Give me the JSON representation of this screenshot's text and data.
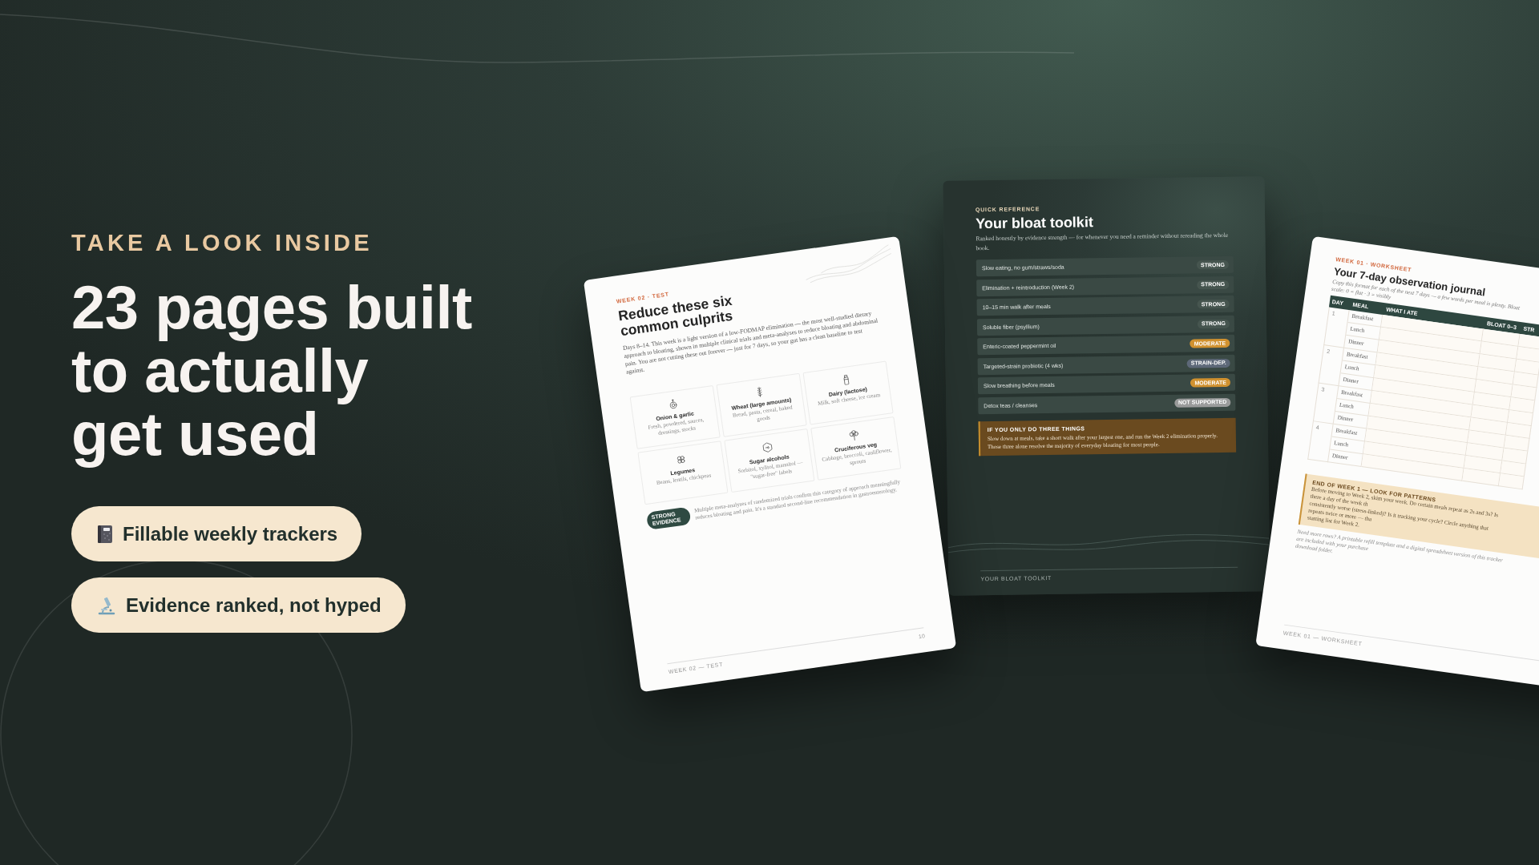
{
  "hero": {
    "eyebrow": "TAKE A LOOK INSIDE",
    "headline": "23 pages built\nto actually\nget used",
    "features": [
      {
        "kind": "notebook",
        "label": "Fillable weekly trackers"
      },
      {
        "kind": "microscope",
        "label": "Evidence ranked, not hyped"
      }
    ]
  },
  "pages": [
    {
      "kind": "culprits",
      "label": "WEEK 02 · TEST",
      "title": "Reduce these six common culprits",
      "intro": "Days 8–14. This week is a light version of a low-FODMAP elimination — the most well-studied dietary approach to bloating, shown in multiple clinical trials and meta-analyses to reduce bloating and abdominal pain. You are not cutting these out forever — just for 7 days, so your gut has a clean baseline to test against.",
      "items": [
        {
          "kind": "onion",
          "name": "Onion & garlic",
          "examples": "Fresh, powdered, sauces, dressings, stocks"
        },
        {
          "kind": "wheat",
          "name": "Wheat (large amounts)",
          "examples": "Bread, pasta, cereal, baked goods"
        },
        {
          "kind": "milk",
          "name": "Dairy (lactose)",
          "examples": "Milk, soft cheese, ice cream"
        },
        {
          "kind": "legumes",
          "name": "Legumes",
          "examples": "Beans, lentils, chickpeas"
        },
        {
          "kind": "sugar",
          "name": "Sugar alcohols",
          "examples": "Sorbitol, xylitol, mannitol — \"sugar-free\" labels"
        },
        {
          "kind": "broccoli",
          "name": "Cruciferous veg",
          "examples": "Cabbage, broccoli, cauliflower, sprouts"
        }
      ],
      "evidence": {
        "badge": "STRONG EVIDENCE",
        "text": "Multiple meta-analyses of randomized trials confirm this category of approach meaningfully reduces bloating and pain. It's a standard second-line recommendation in gastroenterology."
      },
      "footer": "WEEK 02 — TEST",
      "page_number": "10"
    },
    {
      "kind": "toolkit",
      "label": "QUICK REFERENCE",
      "title": "Your bloat toolkit",
      "intro": "Ranked honestly by evidence strength — for whenever you need a reminder without rereading the whole book.",
      "rows": [
        {
          "name": "Slow eating, no gum/straws/soda",
          "evidence": "STRONG",
          "color": "#46554f"
        },
        {
          "name": "Elimination + reintroduction (Week 2)",
          "evidence": "STRONG",
          "color": "#46554f"
        },
        {
          "name": "10–15 min walk after meals",
          "evidence": "STRONG",
          "color": "#46554f"
        },
        {
          "name": "Soluble fiber (psyllium)",
          "evidence": "STRONG",
          "color": "#46554f"
        },
        {
          "name": "Enteric-coated peppermint oil",
          "evidence": "MODERATE",
          "color": "#d0912f"
        },
        {
          "name": "Targeted-strain probiotic (4 wks)",
          "evidence": "STRAIN-DEP.",
          "color": "#5d6878"
        },
        {
          "name": "Slow breathing before meals",
          "evidence": "MODERATE",
          "color": "#d0912f"
        },
        {
          "name": "Detox teas / cleanses",
          "evidence": "NOT SUPPORTED",
          "color": "#9a9b9b"
        }
      ],
      "callout": {
        "title": "IF YOU ONLY DO THREE THINGS",
        "text": "Slow down at meals, take a short walk after your largest one, and run the Week 2 elimination properly. Those three alone resolve the majority of everyday bloating for most people."
      },
      "footer": "YOUR BLOAT TOOLKIT"
    },
    {
      "kind": "journal",
      "label": "WEEK 01 · WORKSHEET",
      "title": "Your 7-day observation journal",
      "intro": "Copy this format for each of the next 7 days — a few words per meal is plenty. Bloat scale: 0 = flat · 3 = visibly",
      "columns": [
        "DAY",
        "MEAL",
        "WHAT I ATE",
        "BLOAT 0–3",
        "STR"
      ],
      "days": [
        {
          "day": "1",
          "meals": [
            "Breakfast",
            "Lunch",
            "Dinner"
          ]
        },
        {
          "day": "2",
          "meals": [
            "Breakfast",
            "Lunch",
            "Dinner"
          ]
        },
        {
          "day": "3",
          "meals": [
            "Breakfast",
            "Lunch",
            "Dinner"
          ]
        },
        {
          "day": "4",
          "meals": [
            "Breakfast",
            "Lunch",
            "Dinner"
          ]
        }
      ],
      "callout": {
        "title": "END OF WEEK 1 — LOOK FOR PATTERNS",
        "lines": [
          "Before moving to Week 2, skim your week. Do certain meals repeat as 2s and 3s? Is there a day of the week th",
          "consistently worse (stress-linked)? Is it tracking your cycle? Circle anything that repeats twice or more — tha",
          "starting list for Week 2."
        ]
      },
      "note_lines": [
        "Need more rows? A printable refill template and a digital spreadsheet version of this tracker are included with your purchase",
        "download folder."
      ],
      "footer": "WEEK 01 — WORKSHEET"
    }
  ]
}
